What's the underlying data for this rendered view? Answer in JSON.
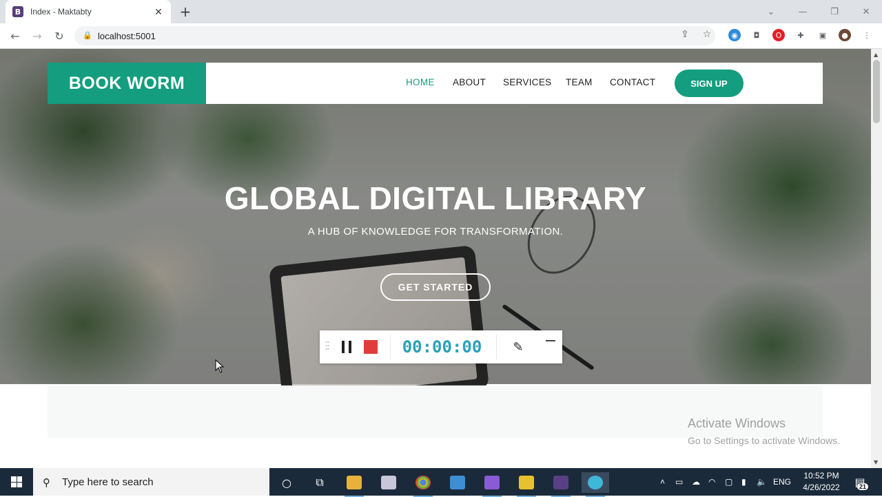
{
  "browser": {
    "tab_title": "Index - Maktabty",
    "tab_favicon": "B",
    "url": "localhost:5001"
  },
  "site": {
    "brand": "BOOK WORM",
    "menu": [
      {
        "label": "HOME",
        "active": true
      },
      {
        "label": "ABOUT",
        "active": false
      },
      {
        "label": "SERVICES",
        "active": false
      },
      {
        "label": "TEAM",
        "active": false
      },
      {
        "label": "CONTACT",
        "active": false
      }
    ],
    "signup_label": "SIGN UP",
    "hero_title": "GLOBAL DIGITAL LIBRARY",
    "hero_subtitle": "A HUB OF KNOWLEDGE FOR TRANSFORMATION.",
    "cta_label": "GET STARTED",
    "accent_color": "#149d7e"
  },
  "recorder": {
    "time": "00:00:00"
  },
  "watermark": {
    "title": "Activate Windows",
    "subtitle": "Go to Settings to activate Windows."
  },
  "taskbar": {
    "search_placeholder": "Type here to search",
    "language": "ENG",
    "time": "10:52 PM",
    "date": "4/26/2022",
    "notification_count": "21"
  }
}
